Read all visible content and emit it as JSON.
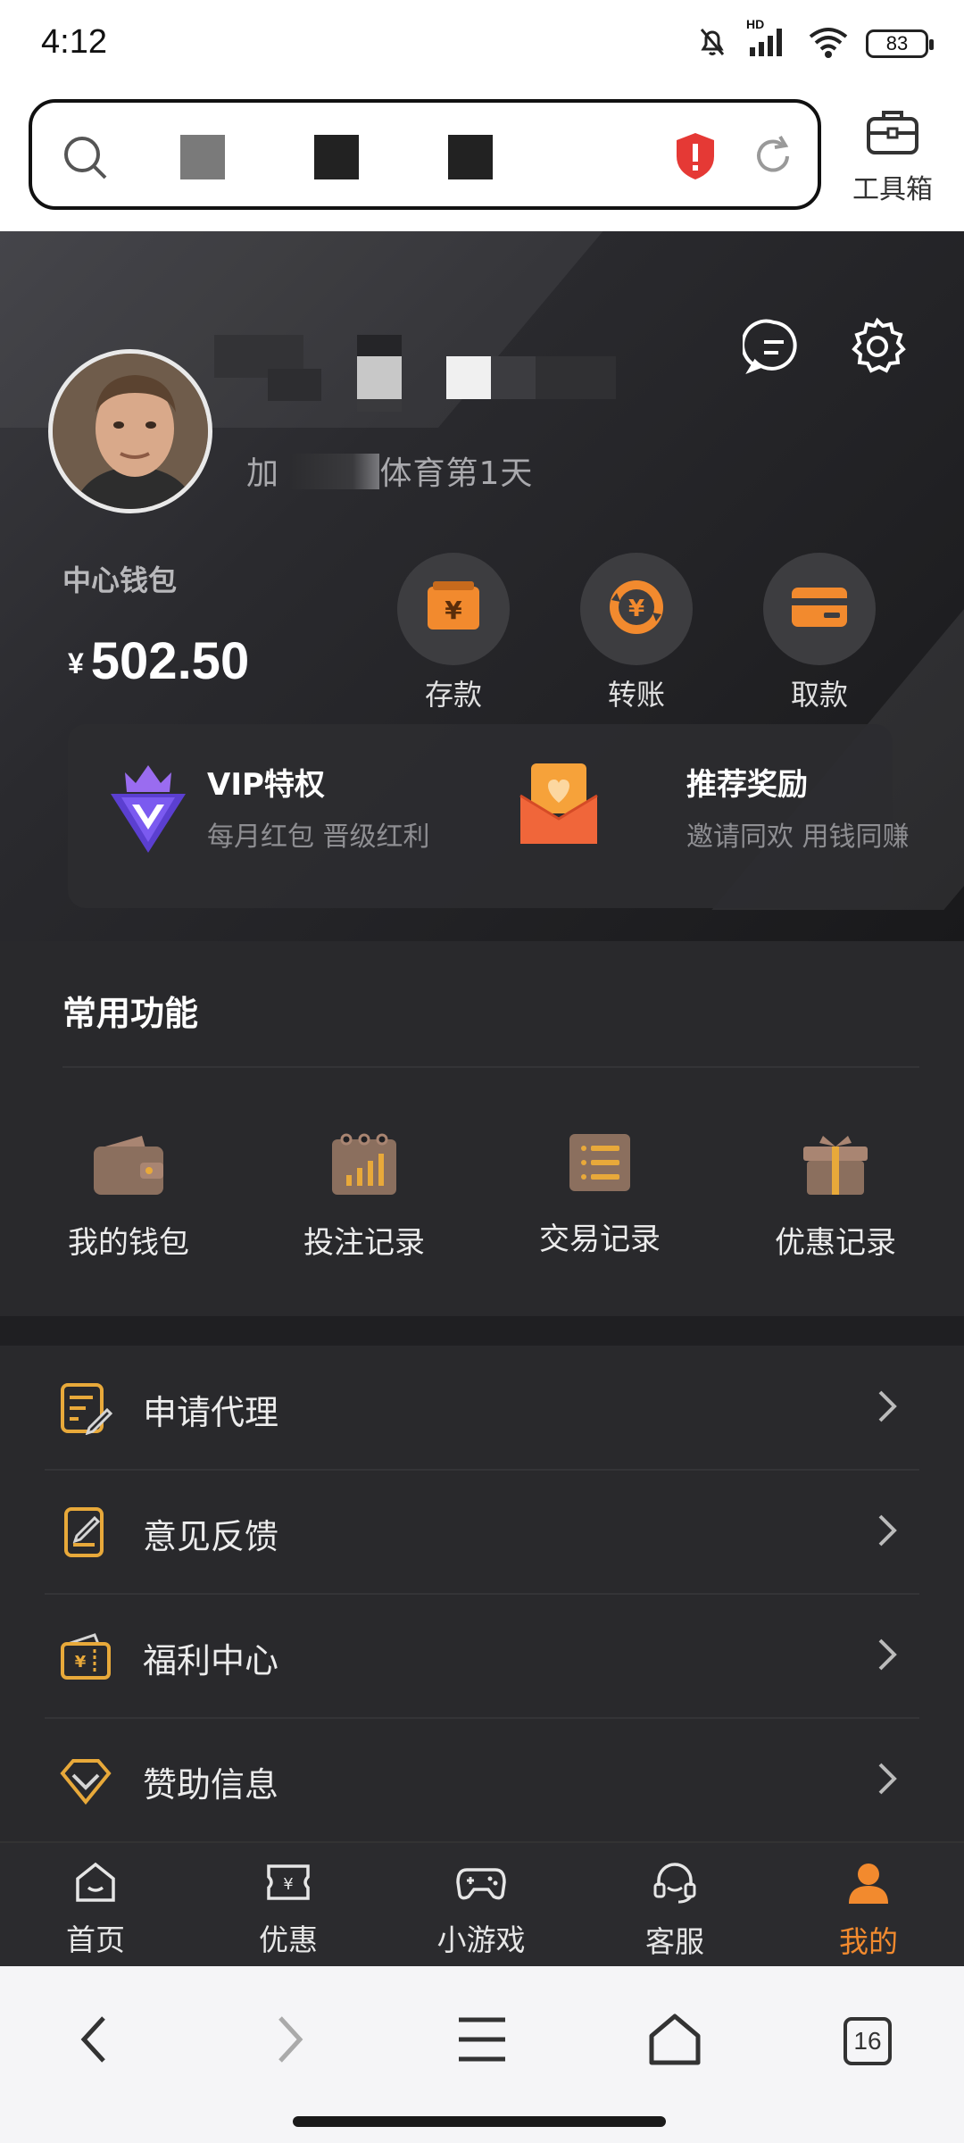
{
  "status_bar": {
    "time": "4:12",
    "hd_label": "HD",
    "battery": "83"
  },
  "browser": {
    "toolbox_label": "工具箱"
  },
  "profile": {
    "join_prefix": "加",
    "join_suffix": "体育第1天"
  },
  "wallet": {
    "label": "中心钱包",
    "currency_symbol": "¥",
    "amount": "502.50",
    "actions": [
      {
        "label": "存款",
        "icon": "deposit-icon"
      },
      {
        "label": "转账",
        "icon": "transfer-icon"
      },
      {
        "label": "取款",
        "icon": "withdraw-icon"
      }
    ]
  },
  "promos": [
    {
      "title": "VIP特权",
      "subtitle": "每月红包 晋级红利",
      "icon": "vip-crown-icon"
    },
    {
      "title": "推荐奖励",
      "subtitle": "邀请同欢 用钱同赚",
      "icon": "envelope-heart-icon"
    }
  ],
  "features": {
    "title": "常用功能",
    "items": [
      {
        "label": "我的钱包",
        "icon": "wallet-icon"
      },
      {
        "label": "投注记录",
        "icon": "bet-record-icon"
      },
      {
        "label": "交易记录",
        "icon": "transaction-record-icon"
      },
      {
        "label": "优惠记录",
        "icon": "gift-icon"
      }
    ]
  },
  "menu": [
    {
      "label": "申请代理",
      "icon": "agent-apply-icon"
    },
    {
      "label": "意见反馈",
      "icon": "feedback-icon"
    },
    {
      "label": "福利中心",
      "icon": "welfare-icon"
    },
    {
      "label": "赞助信息",
      "icon": "sponsor-icon"
    }
  ],
  "tabbar": [
    {
      "label": "首页",
      "icon": "home-tab-icon"
    },
    {
      "label": "优惠",
      "icon": "coupon-tab-icon"
    },
    {
      "label": "小游戏",
      "icon": "gamepad-tab-icon"
    },
    {
      "label": "客服",
      "icon": "headset-tab-icon"
    },
    {
      "label": "我的",
      "icon": "user-tab-icon",
      "active": true
    }
  ],
  "navbar": {
    "tab_count": "16"
  },
  "colors": {
    "accent": "#f28a2e",
    "icon_brown": "#8b6f5e",
    "icon_gold": "#e8a93a",
    "background": "#29292c",
    "shield_red": "#e53935"
  }
}
